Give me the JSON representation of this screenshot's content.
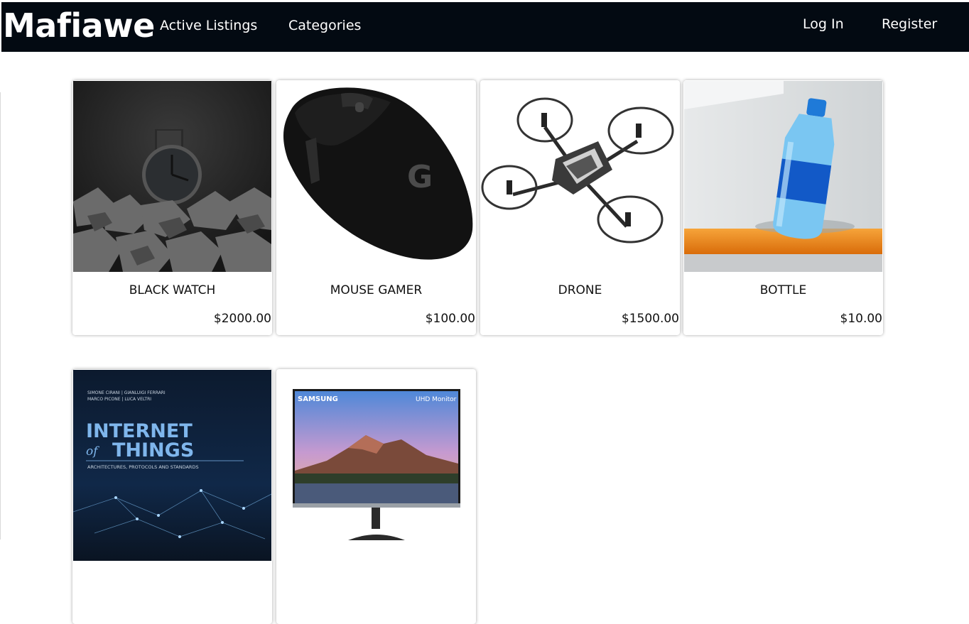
{
  "nav": {
    "brand": "Mafiawe",
    "links": [
      "Active Listings",
      "Categories"
    ],
    "login": "Log In",
    "register": "Register"
  },
  "listings": [
    {
      "title": "BLACK WATCH",
      "price": "$2000.00",
      "image_icon": "watch-image"
    },
    {
      "title": "MOUSE GAMER",
      "price": "$100.00",
      "image_icon": "mouse-image"
    },
    {
      "title": "DRONE",
      "price": "$1500.00",
      "image_icon": "drone-image"
    },
    {
      "title": "BOTTLE",
      "price": "$10.00",
      "image_icon": "bottle-image"
    },
    {
      "title": "",
      "price": "",
      "image_icon": "book-image"
    },
    {
      "title": "",
      "price": "",
      "image_icon": "monitor-image"
    }
  ],
  "book_cover": {
    "authors_line1": "SIMONE CIRANI | GIANLUIGI FERRARI",
    "authors_line2": "MARCO PICONE | LUCA VELTRI",
    "title_line1": "INTERNET",
    "title_of": "of",
    "title_line2": "THINGS",
    "subtitle": "ARCHITECTURES, PROTOCOLS AND STANDARDS"
  },
  "monitor": {
    "brand": "SAMSUNG",
    "label": "UHD Monitor"
  },
  "colors": {
    "navbar": "#030a12",
    "card_bg": "#ffffff",
    "text": "#111111"
  }
}
